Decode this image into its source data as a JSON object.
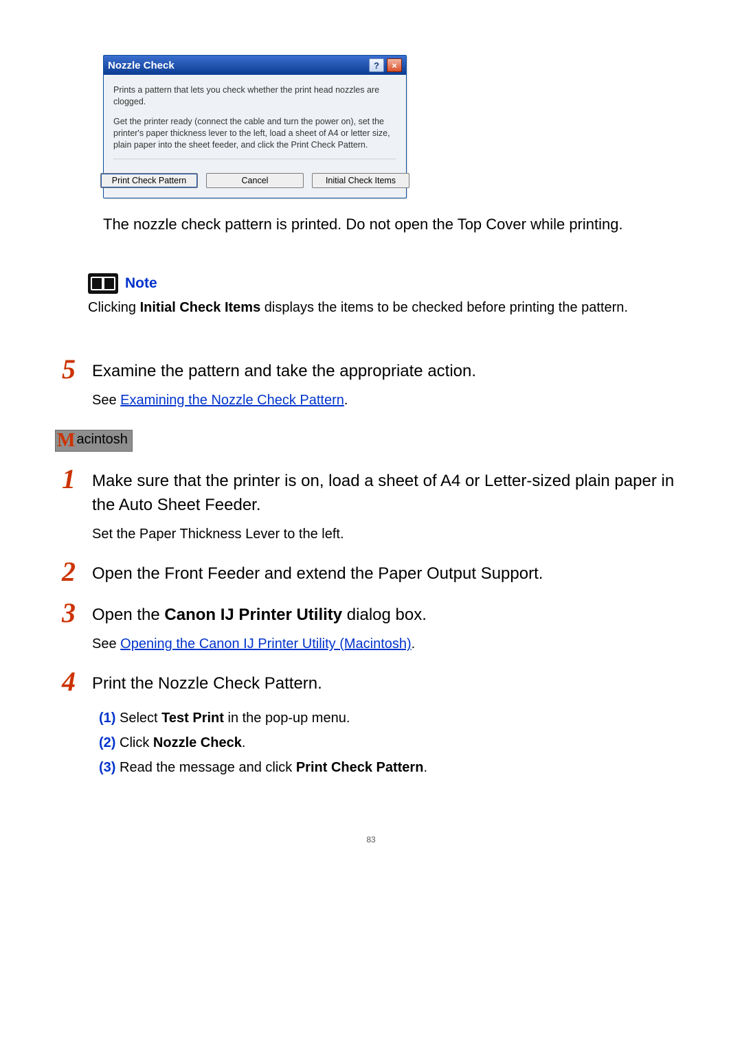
{
  "dialog": {
    "title": "Nozzle Check",
    "help_symbol": "?",
    "close_symbol": "×",
    "msg1": "Prints a pattern that lets you check whether the print head nozzles are clogged.",
    "msg2": "Get the printer ready (connect the cable and turn the power on), set the printer's paper thickness lever to the left, load a sheet of A4 or letter size, plain paper into the sheet feeder, and click the Print Check Pattern.",
    "buttons": {
      "print": "Print Check Pattern",
      "cancel": "Cancel",
      "initial": "Initial Check Items"
    }
  },
  "after_dialog": "The nozzle check pattern is printed. Do not open the Top Cover while printing.",
  "note": {
    "heading": "Note",
    "pre": "Clicking ",
    "bold": "Initial Check Items",
    "post": " displays the items to be checked before printing the pattern."
  },
  "step5": {
    "num": "5",
    "text": "Examine the pattern and take the appropriate action.",
    "see_prefix": "See ",
    "link": "Examining the Nozzle Check Pattern",
    "see_suffix": "."
  },
  "mac": {
    "M": "M",
    "rest": "acintosh"
  },
  "m1": {
    "num": "1",
    "text": "Make sure that the printer is on, load a sheet of A4 or Letter-sized plain paper in the Auto Sheet Feeder.",
    "sub": "Set the Paper Thickness Lever to the left."
  },
  "m2": {
    "num": "2",
    "text": "Open the Front Feeder and extend the Paper Output Support."
  },
  "m3": {
    "num": "3",
    "pre": "Open the ",
    "bold": "Canon IJ Printer Utility",
    "post": " dialog box.",
    "see_prefix": "See ",
    "link": "Opening the Canon IJ Printer Utility (Macintosh)",
    "see_suffix": "."
  },
  "m4": {
    "num": "4",
    "text": "Print the Nozzle Check Pattern.",
    "items": [
      {
        "n": "(1)",
        "pre": "Select ",
        "bold": "Test Print",
        "post": " in the pop-up menu."
      },
      {
        "n": "(2)",
        "pre": "Click ",
        "bold": "Nozzle Check",
        "post": "."
      },
      {
        "n": "(3)",
        "pre": "Read the message and click ",
        "bold": "Print Check Pattern",
        "post": "."
      }
    ]
  },
  "page_number": "83"
}
